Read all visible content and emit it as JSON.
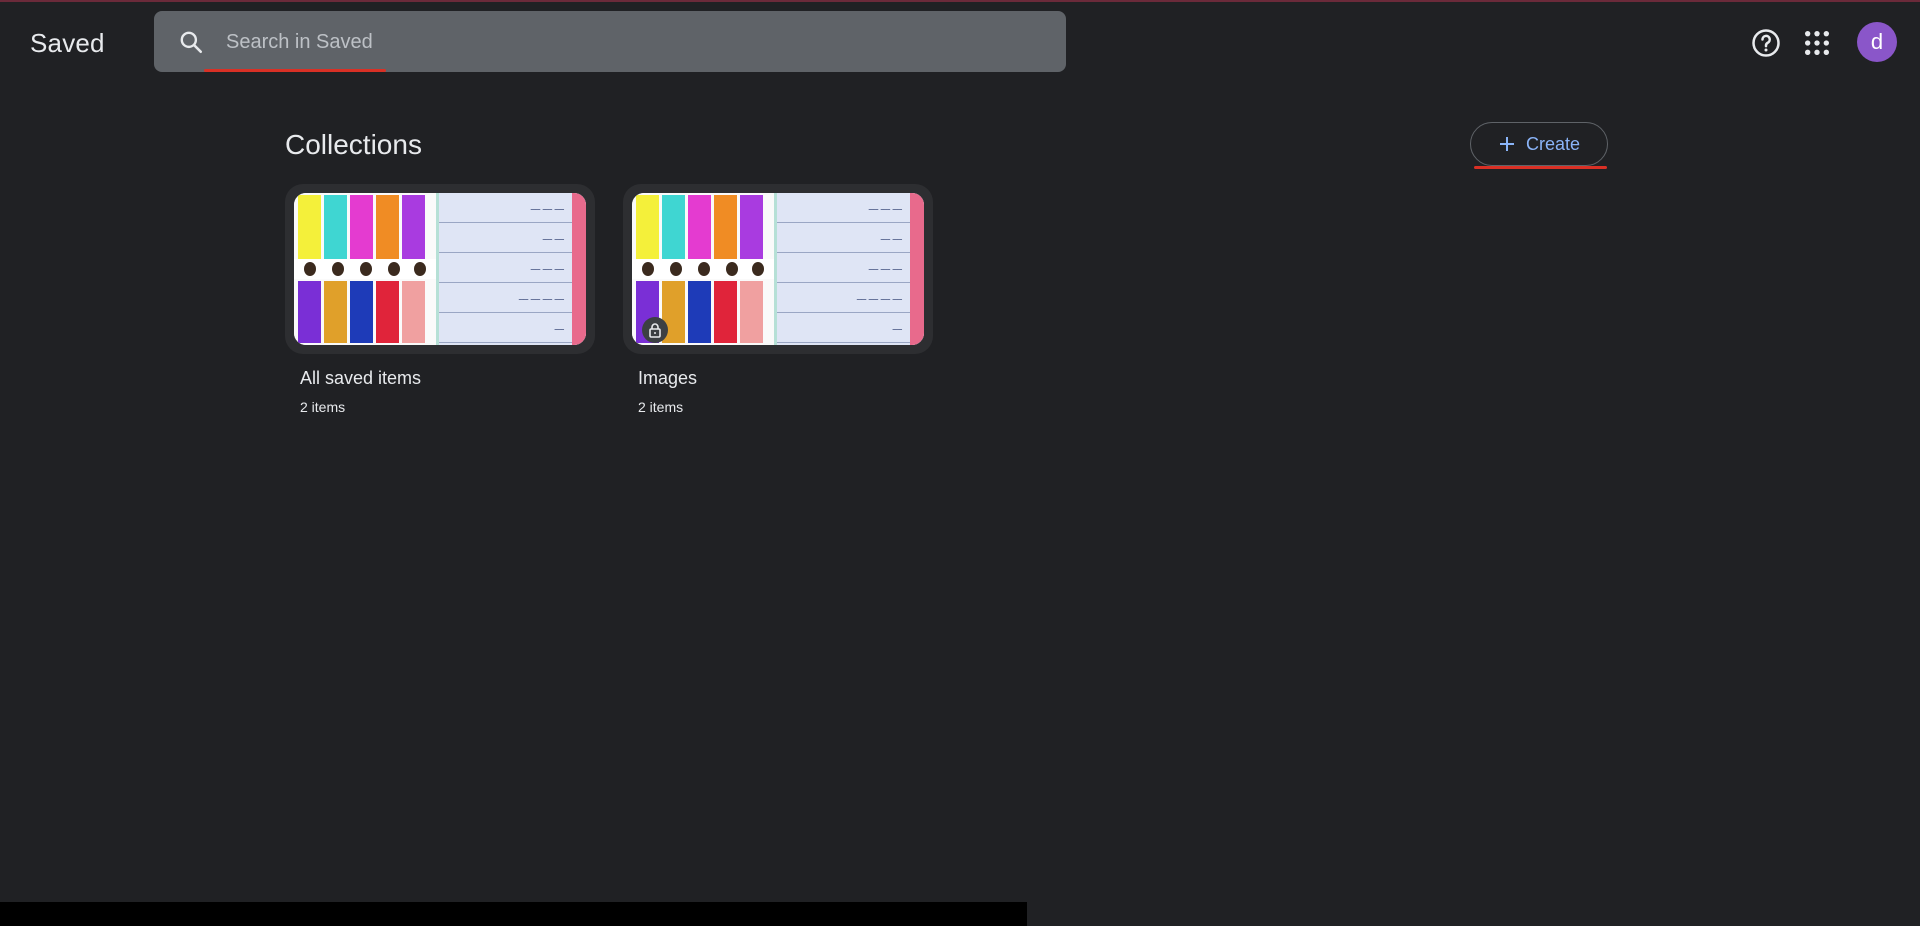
{
  "header": {
    "app_title": "Saved",
    "search_placeholder": "Search in Saved",
    "avatar_letter": "d"
  },
  "main": {
    "section_title": "Collections",
    "create_label": "Create",
    "collections": [
      {
        "title": "All saved items",
        "count": "2 items",
        "locked": false
      },
      {
        "title": "Images",
        "count": "2 items",
        "locked": true
      }
    ]
  },
  "colors": {
    "background": "#202124",
    "search_bg": "#5f6368",
    "accent_blue": "#8ab4f8",
    "avatar": "#8a56c9",
    "annotation_red": "#d93025"
  },
  "icons": {
    "search": "search-icon",
    "help": "help-circle-icon",
    "apps": "apps-grid-icon",
    "create": "plus-icon",
    "lock": "lock-icon"
  }
}
